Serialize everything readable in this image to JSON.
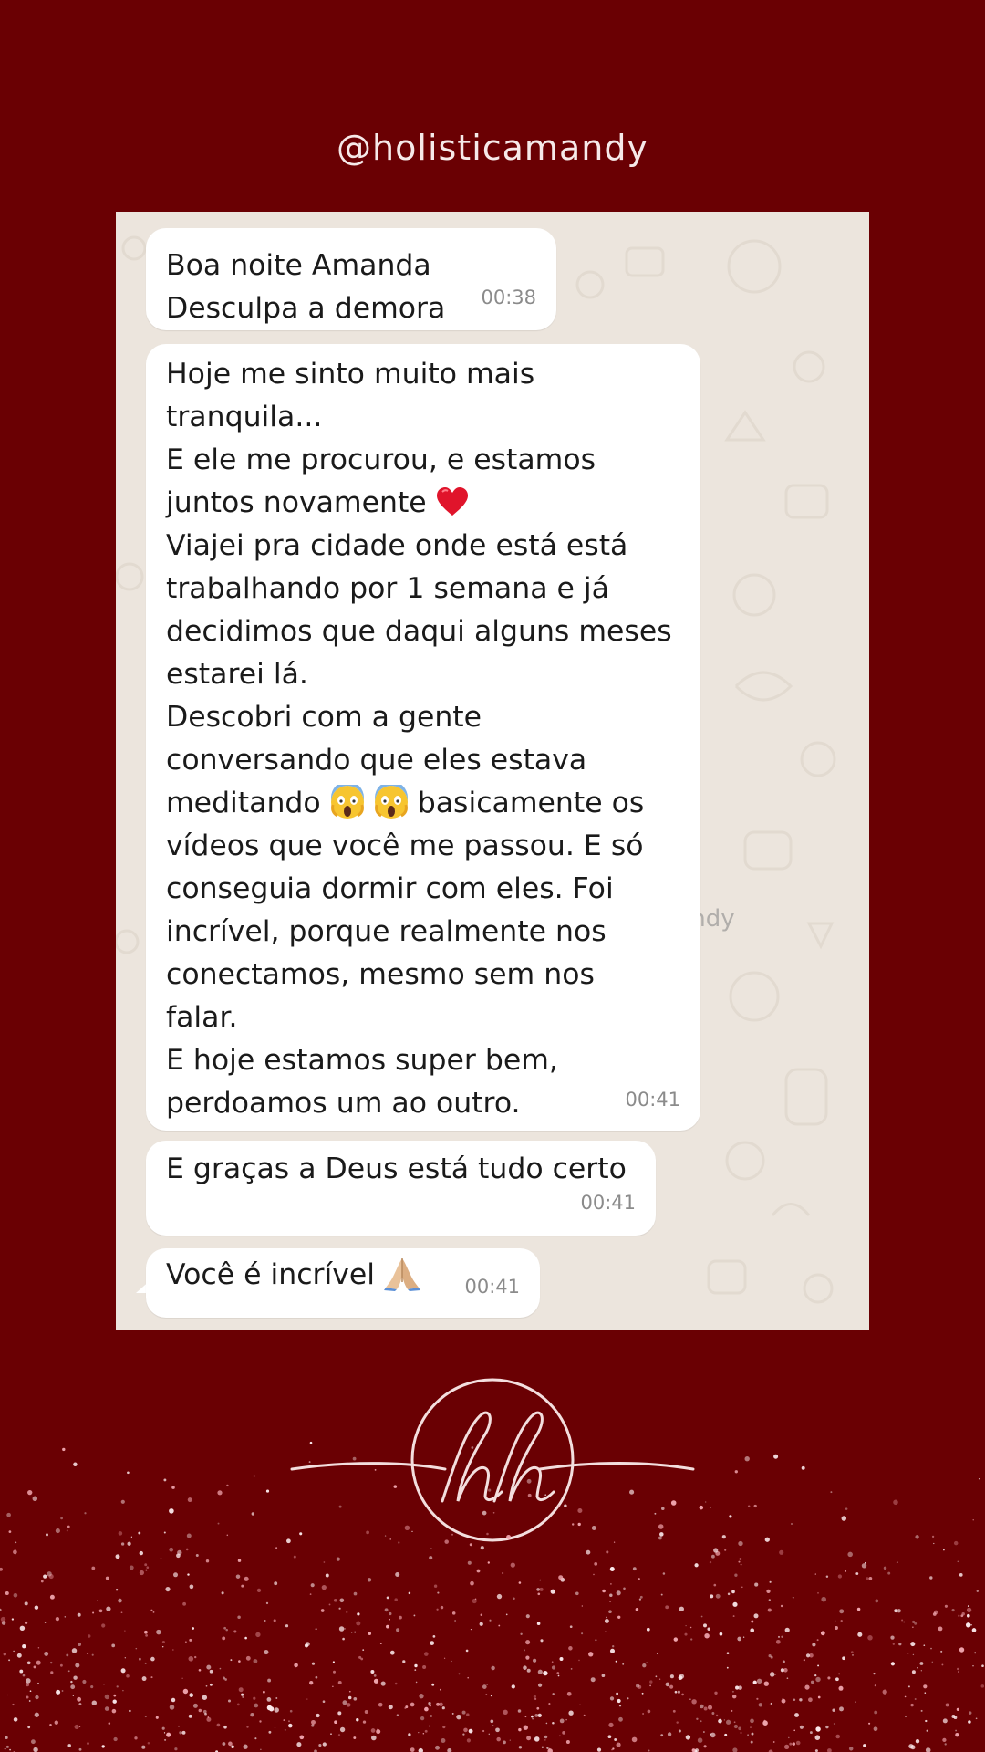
{
  "header": {
    "handle": "@holisticamandy"
  },
  "chat": {
    "watermark": "@holisticamandy",
    "messages": [
      {
        "lines": [
          "Boa noite Amanda",
          "Desculpa a demora"
        ],
        "time": "00:38"
      },
      {
        "lines": [
          "Hoje me sinto muito mais",
          "tranquila...",
          "E ele me procurou, e estamos",
          "juntos novamente",
          "Viajei pra cidade onde está está",
          "trabalhando por 1 semana e já",
          "decidimos que daqui alguns meses",
          "estarei lá.",
          "Descobri com a gente",
          "conversando que eles estava",
          "meditando",
          "basicamente os",
          "vídeos que você me passou. E só",
          "conseguia dormir com eles. Foi",
          "incrível, porque realmente nos",
          "conectamos, mesmo sem nos",
          "falar.",
          "E hoje estamos super bem,",
          "perdoamos um ao outro."
        ],
        "time": "00:41"
      },
      {
        "lines": [
          "E graças a Deus está tudo certo"
        ],
        "time": "00:41"
      },
      {
        "lines": [
          "Você é incrível"
        ],
        "time": "00:41"
      }
    ]
  },
  "icons": {
    "heart": "red-heart-emoji",
    "scream": "face-screaming-in-fear-emoji",
    "pray": "folded-hands-emoji",
    "logo": "hh-monogram-logo"
  },
  "colors": {
    "background": "#6a0003",
    "chat_background": "#ece5dd",
    "bubble": "#ffffff",
    "text": "#1a1a1a",
    "timestamp": "#8b8b8b"
  }
}
